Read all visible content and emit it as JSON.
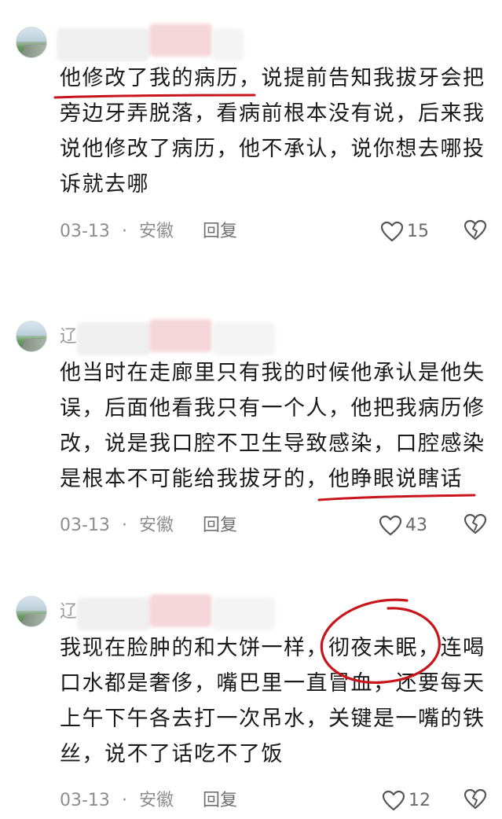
{
  "comments": [
    {
      "username": "",
      "text": "他修改了我的病历，说提前告知我拔牙会把旁边牙弄脱落，看病前根本没有说，后来我说他修改了病历，他不承认，说你想去哪投诉就去哪",
      "date": "03-13",
      "separator": "·",
      "location": "安徽",
      "reply_label": "回复",
      "likes": "15"
    },
    {
      "username": "辽",
      "text": "他当时在走廊里只有我的时候他承认是他失误，后面他看我只有一个人，他把我病历修改，说是我口腔不卫生导致感染，口腔感染是根本不可能给我拔牙的，他睁眼说瞎话",
      "date": "03-13",
      "separator": "·",
      "location": "安徽",
      "reply_label": "回复",
      "likes": "43"
    },
    {
      "username": "辽",
      "text": "我现在脸肿的和大饼一样，彻夜未眠，连喝口水都是奢侈，嘴巴里一直冒血，还要每天上午下午各去打一次吊水，关键是一嘴的铁丝，说不了话吃不了饭",
      "date": "03-13",
      "separator": "·",
      "location": "安徽",
      "reply_label": "回复",
      "likes": "12"
    }
  ],
  "colors": {
    "annotation_red": "#c8151c",
    "meta_gray": "#8d8d8d",
    "mask_gray": "#ececec",
    "mask_pink": "#f5d6da"
  },
  "icons": [
    "heart-icon",
    "broken-heart-icon"
  ]
}
